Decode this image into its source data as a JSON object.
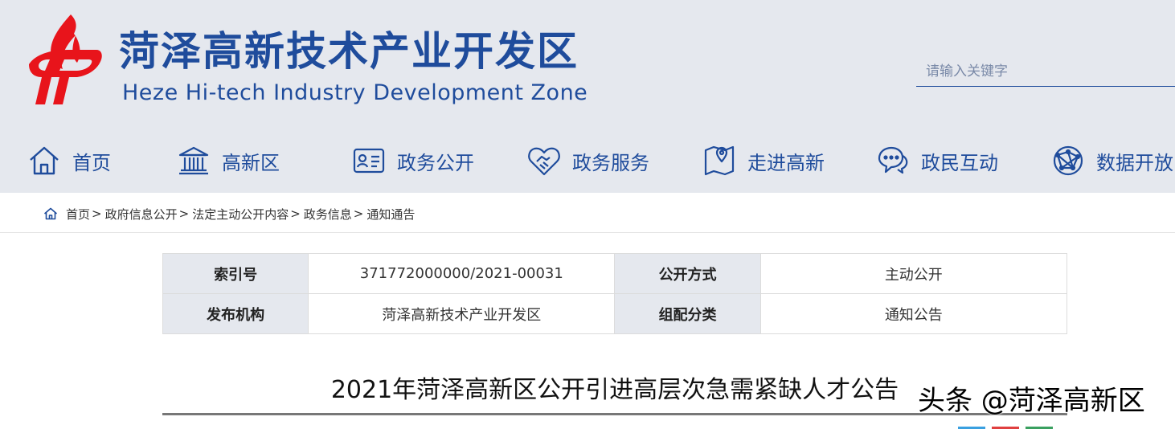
{
  "header": {
    "title_cn": "菏泽高新技术产业开发区",
    "title_en": "Heze Hi-tech Industry Development Zone",
    "brand_color": "#1f4c9c",
    "logo_color": "#e8141b",
    "logo_icon": "torch-logo-icon"
  },
  "search": {
    "placeholder": "请输入关键字",
    "value": ""
  },
  "nav": [
    {
      "label": "首页",
      "icon": "home-icon"
    },
    {
      "label": "高新区",
      "icon": "building-icon"
    },
    {
      "label": "政务公开",
      "icon": "id-card-icon"
    },
    {
      "label": "政务服务",
      "icon": "handshake-icon"
    },
    {
      "label": "走进高新",
      "icon": "map-pin-icon"
    },
    {
      "label": "政民互动",
      "icon": "chat-icon"
    },
    {
      "label": "数据开放",
      "icon": "globe-network-icon"
    }
  ],
  "breadcrumb": {
    "items": [
      "首页",
      "政府信息公开",
      "法定主动公开内容",
      "政务信息",
      "通知通告"
    ],
    "separator": ">"
  },
  "meta": {
    "index_label": "索引号",
    "index_value": "371772000000/2021-00031",
    "method_label": "公开方式",
    "method_value": "主动公开",
    "publisher_label": "发布机构",
    "publisher_value": "菏泽高新技术产业开发区",
    "category_label": "组配分类",
    "category_value": "通知公告"
  },
  "article": {
    "title": "2021年菏泽高新区公开引进高层次急需紧缺人才公告"
  },
  "watermark": {
    "text": "头条 @菏泽高新区"
  }
}
